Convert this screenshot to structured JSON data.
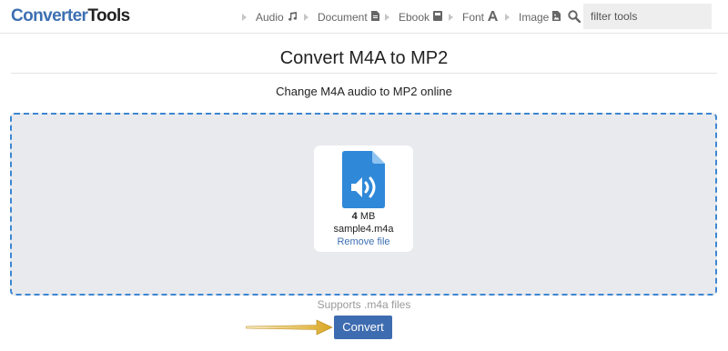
{
  "header": {
    "logo_part1": "Converter",
    "logo_part2": "Tools",
    "nav": [
      {
        "label": "Audio",
        "icon": "music-note-icon"
      },
      {
        "label": "Document",
        "icon": "document-icon"
      },
      {
        "label": "Ebook",
        "icon": "book-icon"
      },
      {
        "label": "Font",
        "icon": "font-icon"
      },
      {
        "label": "Image",
        "icon": "image-file-icon"
      }
    ],
    "search": {
      "placeholder": "filter tools",
      "value": "",
      "icon": "search-icon"
    }
  },
  "main": {
    "title": "Convert M4A to MP2",
    "subtitle": "Change M4A audio to MP2 online"
  },
  "dropzone": {
    "file": {
      "icon": "audio-file-icon",
      "size_value": "4",
      "size_unit": " MB",
      "name": "sample4.m4a",
      "remove_label": "Remove file"
    },
    "supports_text": "Supports .m4a files"
  },
  "actions": {
    "convert_label": "Convert"
  },
  "colors": {
    "brand_blue": "#3d70b2",
    "dropzone_border": "#3d86d1",
    "dropzone_bg": "#e8eaee",
    "convert_button": "#3e6cb0",
    "file_icon": "#2f88d8",
    "pointer_arrow": "#e0b43a"
  }
}
